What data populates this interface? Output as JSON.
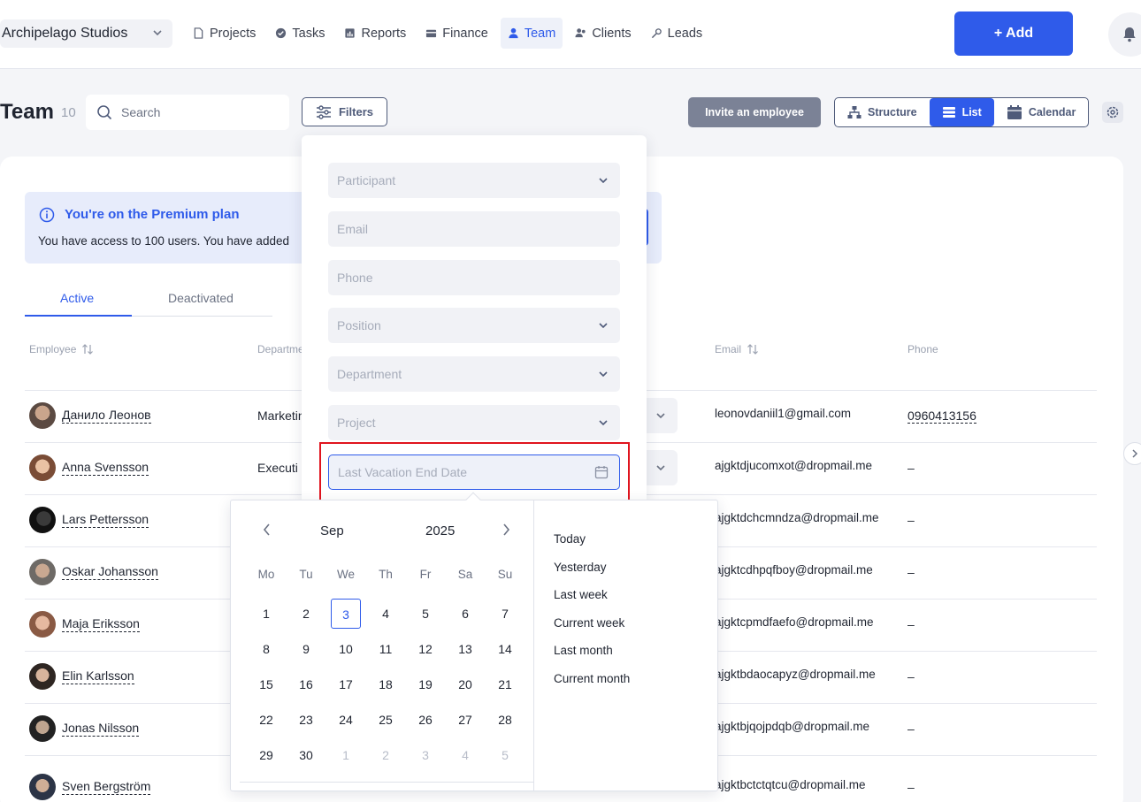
{
  "nav": {
    "company": "Archipelago Studios",
    "items": [
      {
        "label": "Projects",
        "icon": "file-icon"
      },
      {
        "label": "Tasks",
        "icon": "check-circle-icon"
      },
      {
        "label": "Reports",
        "icon": "report-icon"
      },
      {
        "label": "Finance",
        "icon": "wallet-icon"
      },
      {
        "label": "Team",
        "icon": "person-icon",
        "active": true
      },
      {
        "label": "Clients",
        "icon": "clients-icon"
      },
      {
        "label": "Leads",
        "icon": "leads-icon"
      }
    ],
    "add_label": "+ Add"
  },
  "header": {
    "title": "Team",
    "count": "10",
    "search_placeholder": "Search",
    "filters_label": "Filters",
    "invite_label": "Invite an employee",
    "views": [
      "Structure",
      "List",
      "Calendar"
    ],
    "active_view": "List"
  },
  "premium": {
    "title": "You're on the Premium plan",
    "text": "You have access to 100 users. You have added"
  },
  "tabs": {
    "active": "Active",
    "deactivated": "Deactivated"
  },
  "columns": {
    "employee": "Employee",
    "department": "Departme",
    "email": "Email",
    "phone": "Phone"
  },
  "employees": [
    {
      "name": "Данило Леонов",
      "dept": "Marketin",
      "email": "leonovdaniil1@gmail.com",
      "phone": "0960413156"
    },
    {
      "name": "Anna Svensson",
      "dept": "Executi",
      "email": "ajgktdjucomxot@dropmail.me",
      "phone": "–"
    },
    {
      "name": "Lars Pettersson",
      "dept": "",
      "email": "ajgktdchcmndza@dropmail.me",
      "phone": "–"
    },
    {
      "name": "Oskar Johansson",
      "dept": "",
      "email": "ajgktcdhpqfboy@dropmail.me",
      "phone": "–"
    },
    {
      "name": "Maja Eriksson",
      "dept": "",
      "email": "ajgktcpmdfaefo@dropmail.me",
      "phone": "–"
    },
    {
      "name": "Elin Karlsson",
      "dept": "",
      "email": "ajgktbdaocapyz@dropmail.me",
      "phone": "–"
    },
    {
      "name": "Jonas Nilsson",
      "dept": "",
      "email": "ajgktbjqojpdqb@dropmail.me",
      "phone": "–"
    },
    {
      "name": "Sven Bergström",
      "dept": "",
      "email": "ajgktbctctqtcu@dropmail.me",
      "phone": "–"
    }
  ],
  "filters": {
    "participant": "Participant",
    "email": "Email",
    "phone": "Phone",
    "position": "Position",
    "department": "Department",
    "project": "Project",
    "last_vacation_end": "Last Vacation End Date"
  },
  "calendar": {
    "month": "Sep",
    "year": "2025",
    "weekdays": [
      "Mo",
      "Tu",
      "We",
      "Th",
      "Fr",
      "Sa",
      "Su"
    ],
    "days": [
      [
        "1",
        "2",
        "3",
        "4",
        "5",
        "6",
        "7"
      ],
      [
        "8",
        "9",
        "10",
        "11",
        "12",
        "13",
        "14"
      ],
      [
        "15",
        "16",
        "17",
        "18",
        "19",
        "20",
        "21"
      ],
      [
        "22",
        "23",
        "24",
        "25",
        "26",
        "27",
        "28"
      ],
      [
        "29",
        "30",
        "1",
        "2",
        "3",
        "4",
        "5"
      ]
    ],
    "today": "3",
    "presets": [
      "Today",
      "Yesterday",
      "Last week",
      "Current week",
      "Last month",
      "Current month"
    ]
  },
  "colors": {
    "accent": "#2f5bea",
    "highlight": "#e0141e"
  }
}
